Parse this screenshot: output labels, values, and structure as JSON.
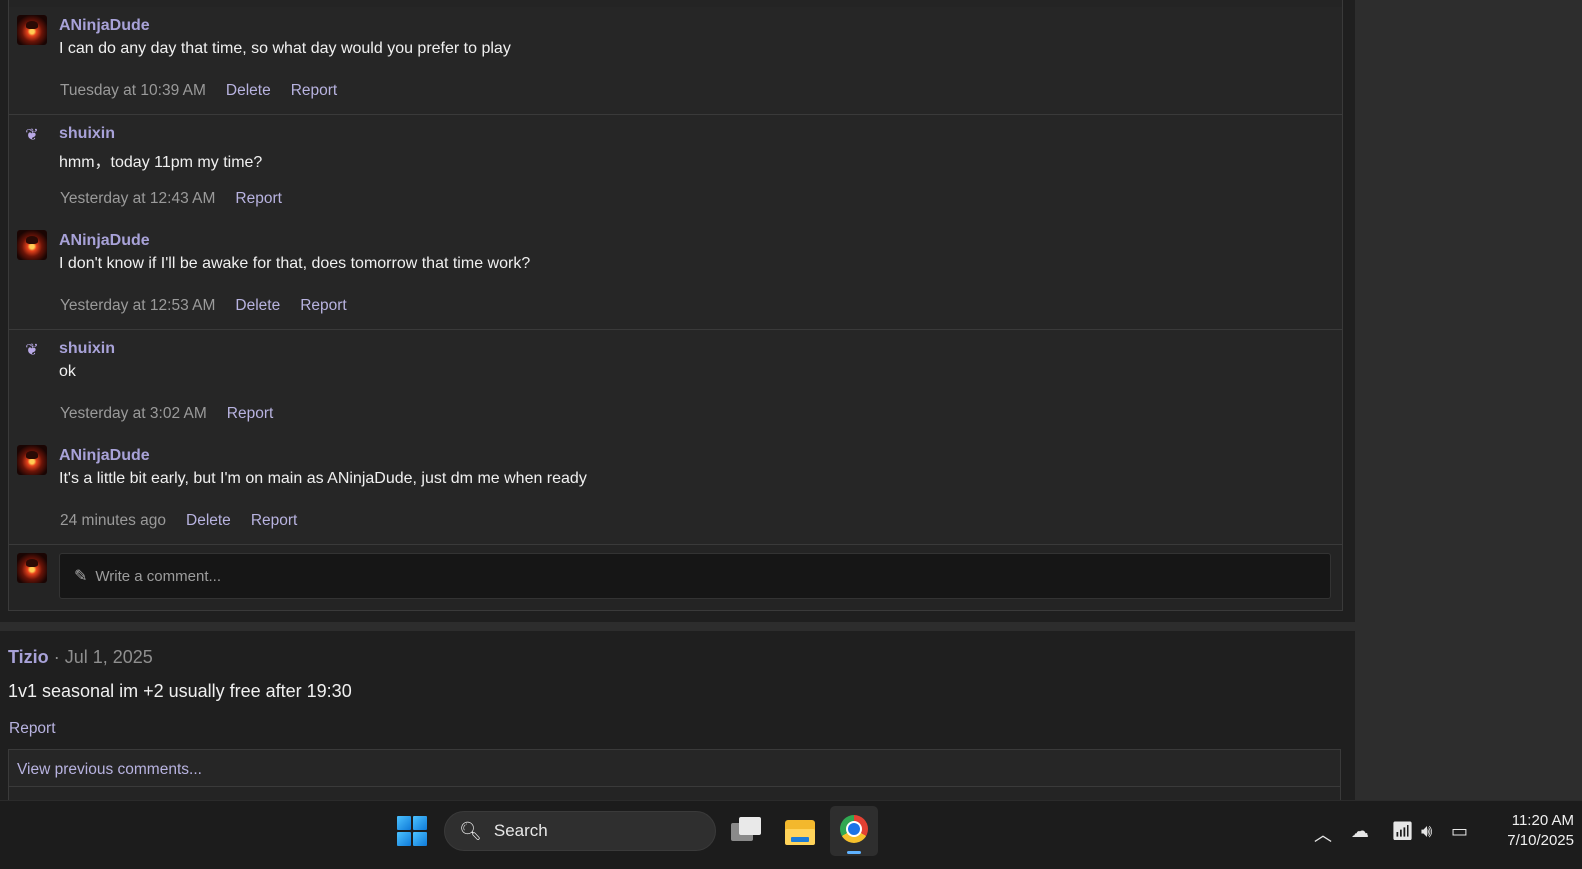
{
  "comments": [
    {
      "user": "ANinjaDude",
      "avatar": "ninja-avatar",
      "text": "I can do any day that time, so what day would you prefer to play",
      "time": "Tuesday at 10:39 AM",
      "delete": "Delete",
      "report": "Report"
    },
    {
      "user": "shuixin",
      "avatar": "butterfly-avatar",
      "text": "hmm，today 11pm my time?",
      "time": "Yesterday at 12:43 AM",
      "report": "Report"
    },
    {
      "user": "ANinjaDude",
      "avatar": "ninja-avatar",
      "text": "I don't know if I'll be awake for that, does tomorrow that time work?",
      "time": "Yesterday at 12:53 AM",
      "delete": "Delete",
      "report": "Report"
    },
    {
      "user": "shuixin",
      "avatar": "butterfly-avatar",
      "text": "ok",
      "time": "Yesterday at 3:02 AM",
      "report": "Report"
    },
    {
      "user": "ANinjaDude",
      "avatar": "ninja-avatar",
      "text": "It's a little bit early, but I'm on main as ANinjaDude, just dm me when ready",
      "time": "24 minutes ago",
      "delete": "Delete",
      "report": "Report"
    }
  ],
  "write_comment": {
    "placeholder": "Write a comment...",
    "icon": "pencil-icon"
  },
  "post": {
    "author": "Tizio",
    "separator": "·",
    "date": "Jul 1, 2025",
    "text": "1v1 seasonal im +2 usually free after 19:30",
    "report": "Report",
    "view_previous": "View previous comments..."
  },
  "taskbar": {
    "search_label": "Search",
    "time": "11:20 AM",
    "date": "7/10/2025",
    "icons": [
      "windows-start-icon",
      "search-icon",
      "task-view-icon",
      "file-explorer-icon",
      "chrome-icon",
      "chevron-up-icon",
      "onedrive-icon",
      "wifi-icon",
      "volume-icon",
      "battery-icon"
    ]
  },
  "colors": {
    "username": "#a8a2d8",
    "link": "#b8b3e0",
    "background": "#1f1f1f"
  }
}
